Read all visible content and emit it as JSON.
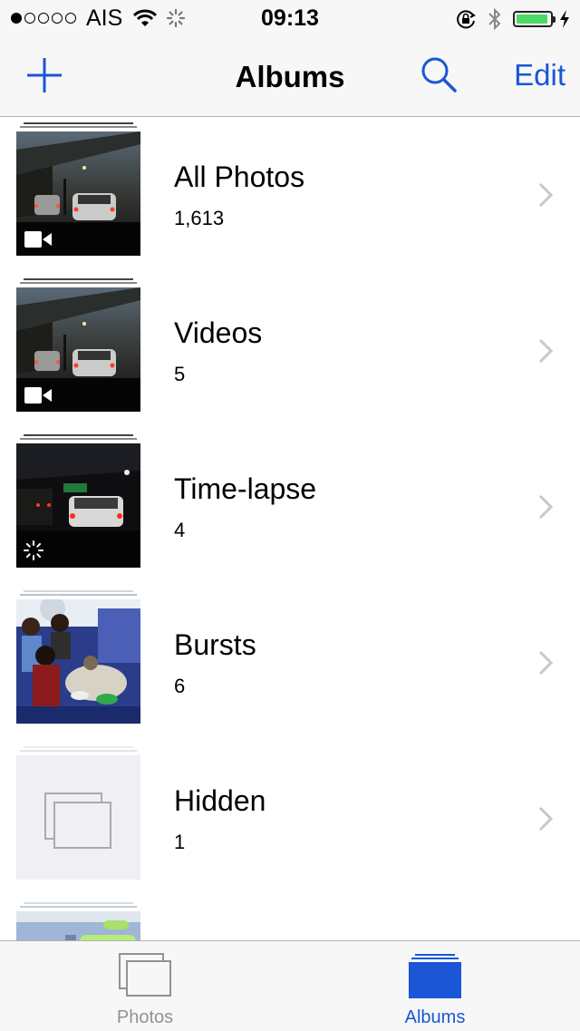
{
  "status_bar": {
    "carrier": "AIS",
    "time": "09:13",
    "signal_bars": 1,
    "signal_max": 5,
    "battery_level": 0.95,
    "battery_color": "#4cd964",
    "icons": [
      "wifi-icon",
      "activity-spinner-icon",
      "rotation-lock-icon",
      "bluetooth-icon",
      "battery-icon",
      "charging-bolt-icon"
    ]
  },
  "nav": {
    "title": "Albums",
    "add_icon": "plus-icon",
    "search_icon": "search-icon",
    "edit_label": "Edit",
    "tint_color": "#1a56d6"
  },
  "albums": [
    {
      "name": "All Photos",
      "count": "1,613",
      "badge_icon": "video-camera-icon",
      "thumbnail": "night-traffic-photo"
    },
    {
      "name": "Videos",
      "count": "5",
      "badge_icon": "video-camera-icon",
      "thumbnail": "night-traffic-photo"
    },
    {
      "name": "Time-lapse",
      "count": "4",
      "badge_icon": "time-lapse-icon",
      "thumbnail": "night-traffic-photo"
    },
    {
      "name": "Bursts",
      "count": "6",
      "badge_icon": "",
      "thumbnail": "dinner-group-photo"
    },
    {
      "name": "Hidden",
      "count": "1",
      "badge_icon": "",
      "thumbnail": "empty-album-placeholder"
    },
    {
      "name": "",
      "count": "",
      "badge_icon": "",
      "thumbnail": "chat-screenshot-photo"
    }
  ],
  "tabs": [
    {
      "label": "Photos",
      "icon": "photos-tab-icon",
      "active": false,
      "color": "#929292"
    },
    {
      "label": "Albums",
      "icon": "albums-tab-icon",
      "active": true,
      "color": "#1a56d6"
    }
  ]
}
